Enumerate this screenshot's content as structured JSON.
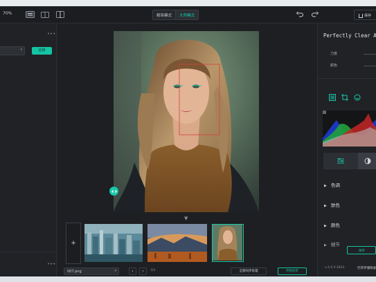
{
  "toolbar": {
    "zoom": "70%",
    "modes": [
      "精简模式",
      "大师模式"
    ],
    "active_mode": "大师模式",
    "save_label": "保存"
  },
  "left_panel": {
    "apply_label": "应用"
  },
  "filmstrip": {
    "add_label": "+",
    "thumbnails": [
      "city-skyline",
      "mountain-sunset",
      "portrait-woman"
    ],
    "selected_index": 2
  },
  "canvas_bottom": {
    "file_name": "007.png",
    "pager": "3/3",
    "sync_all_label": "全部同步处理",
    "sync_label": "开始同步"
  },
  "right_panel": {
    "title": "Perfectly Clear A",
    "slider_labels": [
      "力度",
      "颜色"
    ],
    "sections": [
      "色调",
      "肤色",
      "颜色",
      "细节"
    ],
    "save_small_label": "保存",
    "version": "v-4.0.0.2843",
    "open_folder_label": "打开存储目录"
  },
  "colors": {
    "accent": "#17c9a9",
    "panel_bg": "#202226",
    "toolbar_bg": "#1b1d20"
  }
}
